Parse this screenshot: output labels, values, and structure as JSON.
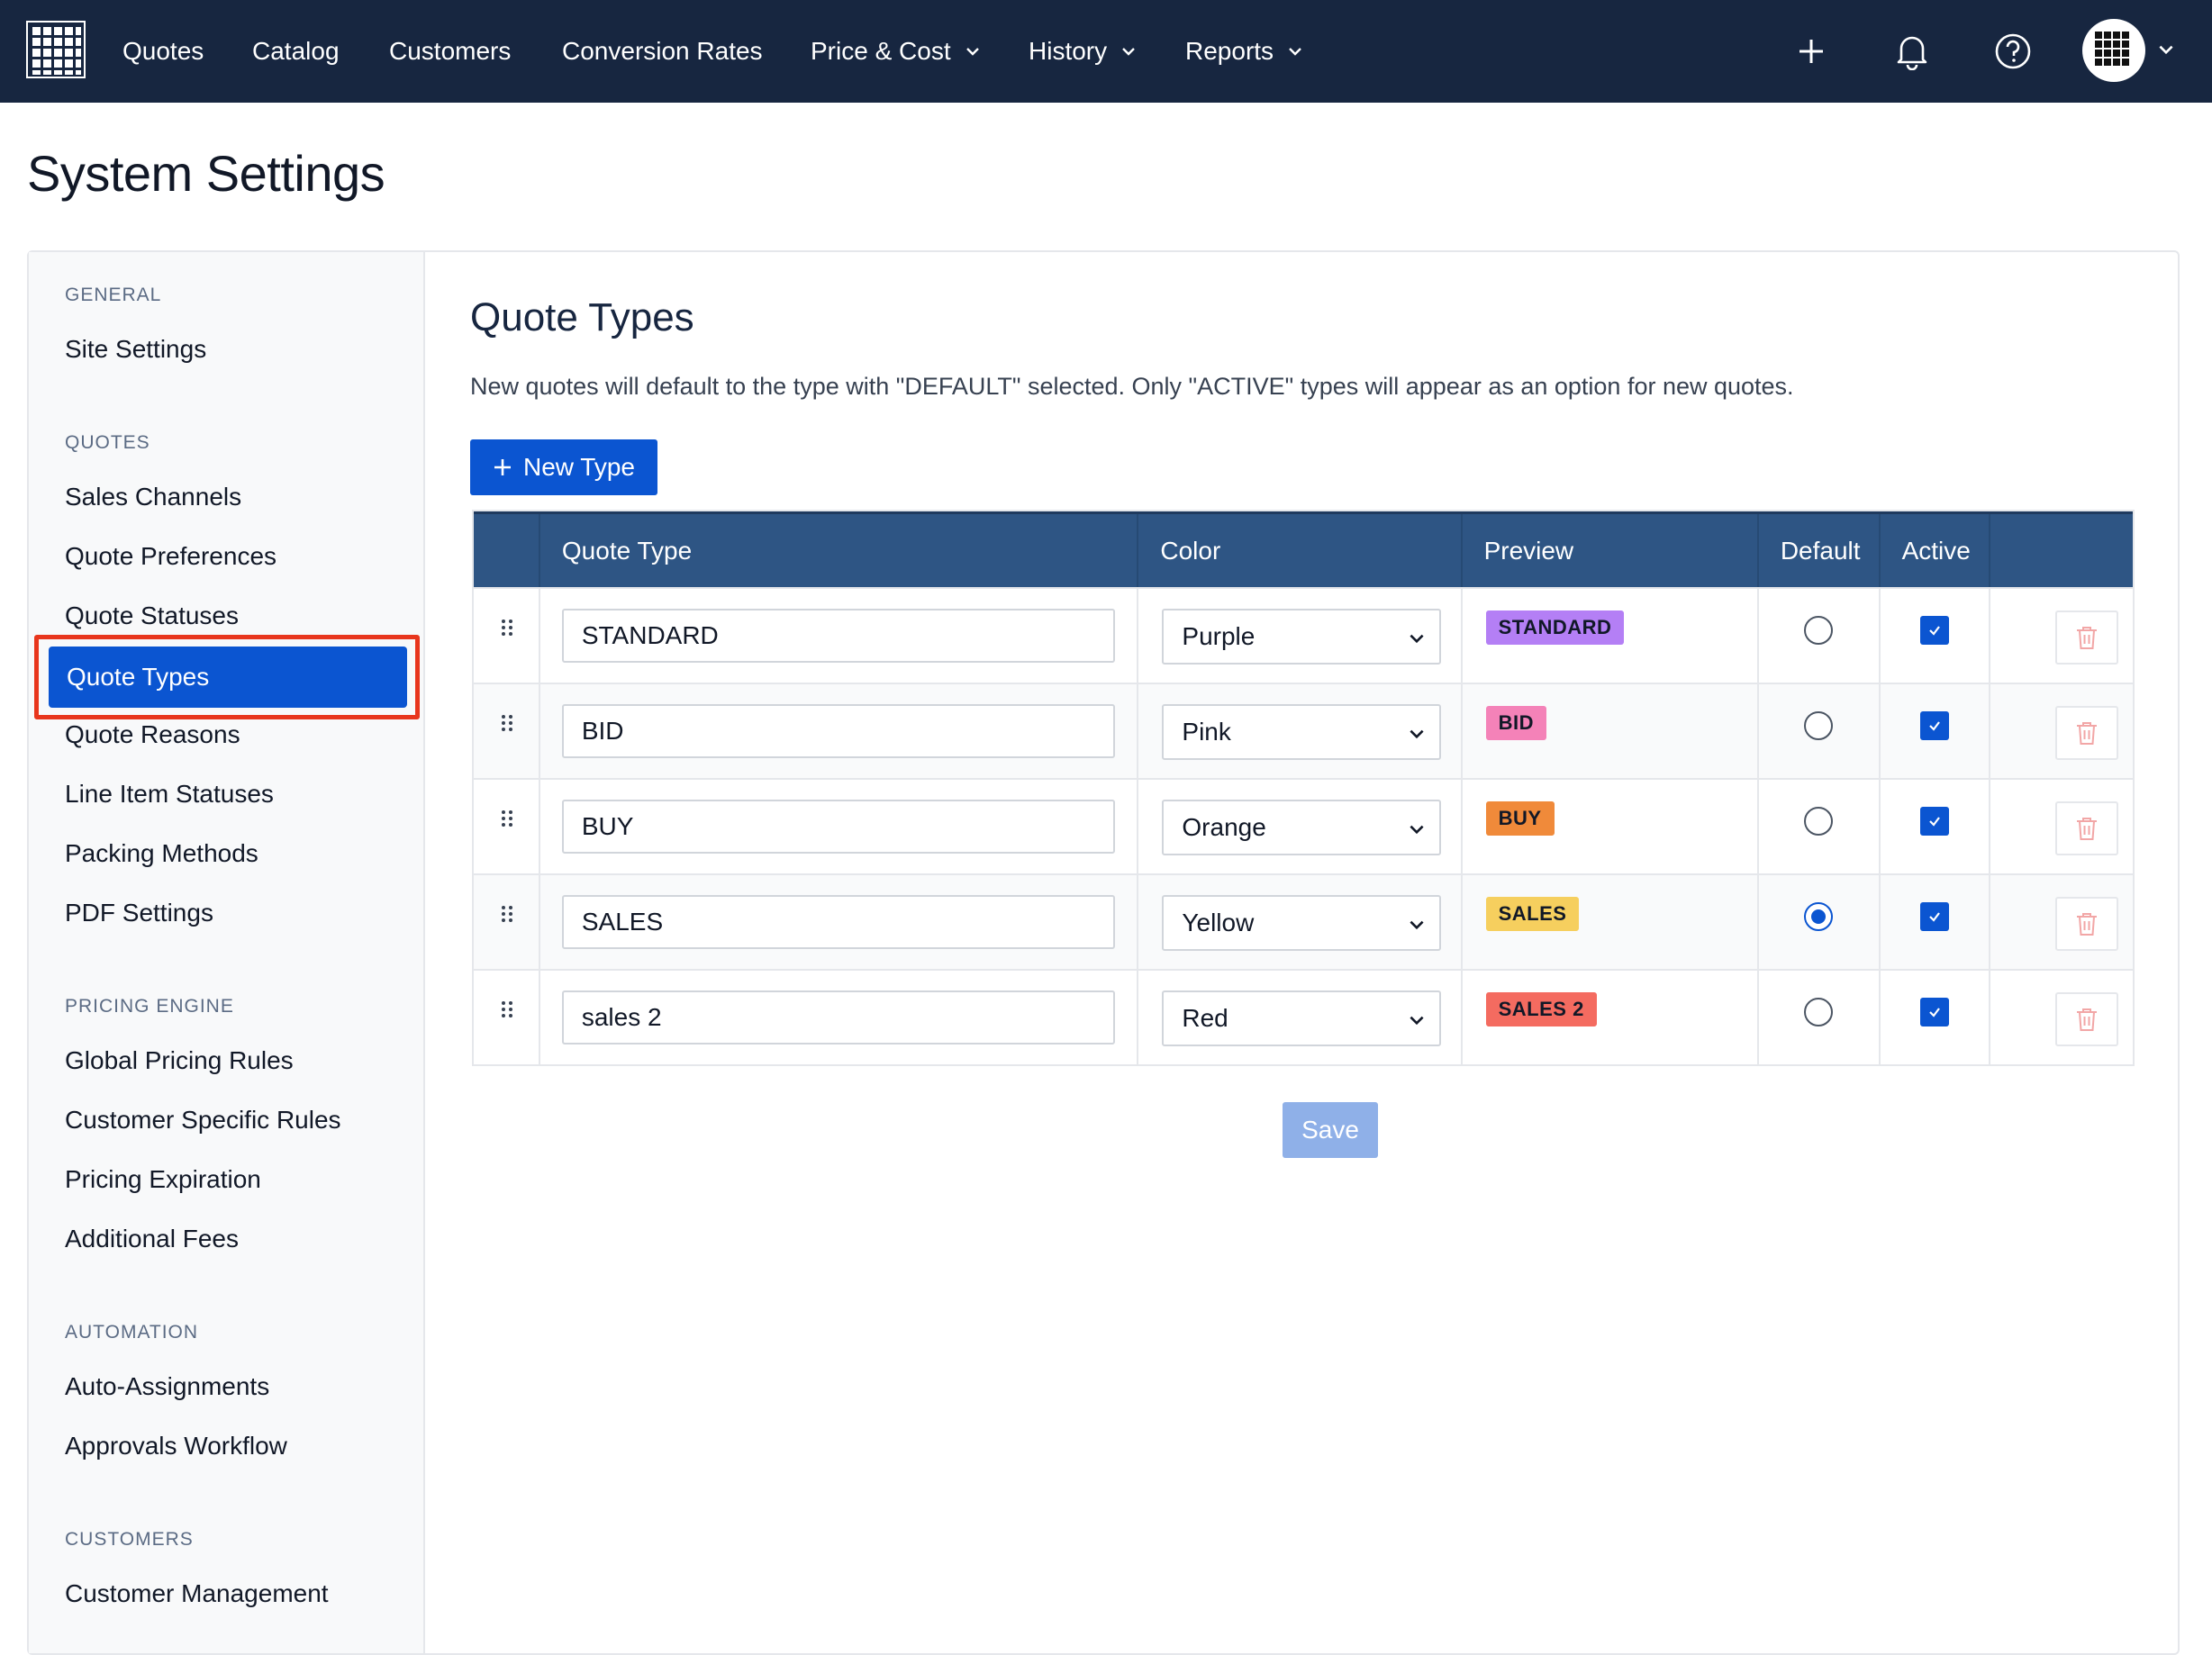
{
  "nav": {
    "logo_icon": "grid-logo-icon",
    "items": [
      {
        "label": "Quotes"
      },
      {
        "label": "Catalog"
      },
      {
        "label": "Customers"
      },
      {
        "label": "Conversion Rates"
      },
      {
        "label": "Price & Cost"
      },
      {
        "label": "History"
      },
      {
        "label": "Reports"
      }
    ],
    "icons": [
      "plus-icon",
      "bell-icon",
      "help-icon",
      "avatar"
    ]
  },
  "page": {
    "title": "System Settings"
  },
  "sidebar": {
    "sections": [
      {
        "title": "GENERAL",
        "items": [
          "Site Settings"
        ]
      },
      {
        "title": "QUOTES",
        "items": [
          "Sales Channels",
          "Quote Preferences",
          "Quote Statuses",
          "Quote Types",
          "Quote Reasons",
          "Line Item Statuses",
          "Packing Methods",
          "PDF Settings"
        ]
      },
      {
        "title": "PRICING ENGINE",
        "items": [
          "Global Pricing Rules",
          "Customer Specific Rules",
          "Pricing Expiration",
          "Additional Fees"
        ]
      },
      {
        "title": "AUTOMATION",
        "items": [
          "Auto-Assignments",
          "Approvals Workflow"
        ]
      },
      {
        "title": "CUSTOMERS",
        "items": [
          "Customer Management"
        ]
      }
    ],
    "active": "Quote Types"
  },
  "main": {
    "title": "Quote Types",
    "description": "New quotes will default to the type with \"DEFAULT\" selected. Only \"ACTIVE\" types will appear as an option for new quotes.",
    "new_button": "New Type",
    "save_button": "Save",
    "columns": [
      "Quote Type",
      "Color",
      "Preview",
      "Default",
      "Active"
    ],
    "rows": [
      {
        "name": "STANDARD",
        "color": "Purple",
        "preview": "STANDARD",
        "badge_color": "#b47ff5",
        "default": false,
        "active": true
      },
      {
        "name": "BID",
        "color": "Pink",
        "preview": "BID",
        "badge_color": "#f482b8",
        "default": false,
        "active": true
      },
      {
        "name": "BUY",
        "color": "Orange",
        "preview": "BUY",
        "badge_color": "#f08a3a",
        "default": false,
        "active": true
      },
      {
        "name": "SALES",
        "color": "Yellow",
        "preview": "SALES",
        "badge_color": "#f6cf5e",
        "default": true,
        "active": true
      },
      {
        "name": "sales 2",
        "color": "Red",
        "preview": "SALES 2",
        "badge_color": "#f46b60",
        "default": false,
        "active": true
      }
    ]
  },
  "colors": {
    "navbar": "#172640",
    "primary": "#0b55d1",
    "table_header": "#2e5584",
    "highlight": "#e8361d"
  }
}
